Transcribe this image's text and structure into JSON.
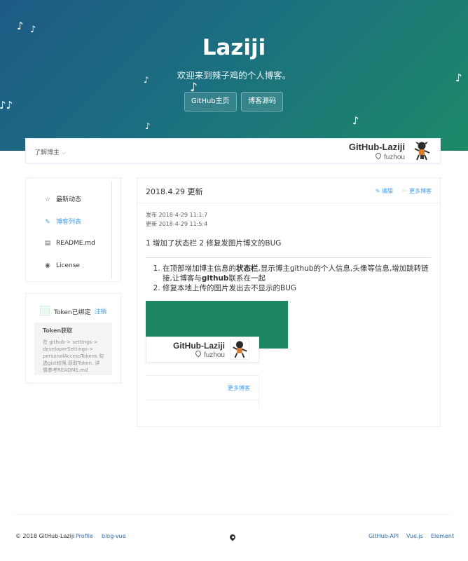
{
  "hero": {
    "title": "Laziji",
    "subtitle": "欢迎来到辣子鸡的个人博客。",
    "buttons": [
      "GitHub主页",
      "博客源码"
    ],
    "note_glyph": "♪",
    "double_note_glyph": "♪♪"
  },
  "profile": {
    "about_label": "了解博主",
    "name": "GitHub-Laziji",
    "location": "fuzhou"
  },
  "sidebar": {
    "items": [
      {
        "label": "最新动态",
        "icon": "star-icon",
        "glyph": "☆",
        "active": false
      },
      {
        "label": "博客列表",
        "icon": "edit-icon",
        "glyph": "✎",
        "active": true
      },
      {
        "label": "README.md",
        "icon": "document-icon",
        "glyph": "▤",
        "active": false
      },
      {
        "label": "License",
        "icon": "target-icon",
        "glyph": "◉",
        "active": false
      }
    ]
  },
  "token": {
    "status_label": "Token已绑定",
    "logout_label": "注销",
    "tip_title": "Token获取",
    "tip_body": "在 github-> settings-> developerSettings-> personalAccessTokens 勾选gist权限,获取Token. 详情参考README.md"
  },
  "post": {
    "title": "2018.4.29 更新",
    "edit_label": "编辑",
    "more_label": "更多博客",
    "published": "发布 2018-4-29 11:1:7",
    "updated": "更新 2018-4-29 11:5:4",
    "summary": "1 增加了状态栏 2 修复发图片博文的BUG",
    "list": [
      {
        "pre": "在顶部增加博主信息的",
        "bold1": "状态栏",
        "mid": ",显示博主github的个人信息,头像等信息,增加跳转链接,让博客与",
        "bold2": "github",
        "post": "联系在一起"
      },
      {
        "text": "修复本地上传的图片发出去不显示的BUG"
      }
    ],
    "preview": {
      "name": "GitHub-Laziji",
      "location": "fuzhou",
      "more_label": "更多博客"
    }
  },
  "footer": {
    "copyright": "© 2018 GitHub-Laziji",
    "links_left": [
      "Profile",
      "blog-vue"
    ],
    "links_right": [
      "GitHub-API",
      "Vue.js",
      "Element"
    ]
  },
  "colors": {
    "hero_start": "#1e5b86",
    "hero_end": "#1d8a68",
    "link": "#409eff",
    "preview_image": "#1d8761"
  }
}
